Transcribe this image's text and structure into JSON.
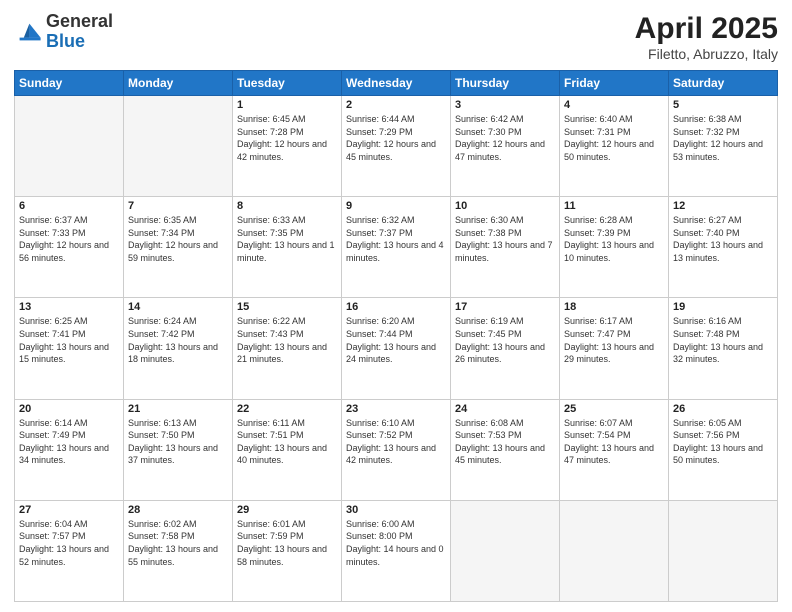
{
  "header": {
    "logo_general": "General",
    "logo_blue": "Blue",
    "title": "April 2025",
    "subtitle": "Filetto, Abruzzo, Italy"
  },
  "days_of_week": [
    "Sunday",
    "Monday",
    "Tuesday",
    "Wednesday",
    "Thursday",
    "Friday",
    "Saturday"
  ],
  "weeks": [
    [
      {
        "day": "",
        "empty": true
      },
      {
        "day": "",
        "empty": true
      },
      {
        "day": "1",
        "sunrise": "6:45 AM",
        "sunset": "7:28 PM",
        "daylight": "12 hours and 42 minutes."
      },
      {
        "day": "2",
        "sunrise": "6:44 AM",
        "sunset": "7:29 PM",
        "daylight": "12 hours and 45 minutes."
      },
      {
        "day": "3",
        "sunrise": "6:42 AM",
        "sunset": "7:30 PM",
        "daylight": "12 hours and 47 minutes."
      },
      {
        "day": "4",
        "sunrise": "6:40 AM",
        "sunset": "7:31 PM",
        "daylight": "12 hours and 50 minutes."
      },
      {
        "day": "5",
        "sunrise": "6:38 AM",
        "sunset": "7:32 PM",
        "daylight": "12 hours and 53 minutes."
      }
    ],
    [
      {
        "day": "6",
        "sunrise": "6:37 AM",
        "sunset": "7:33 PM",
        "daylight": "12 hours and 56 minutes."
      },
      {
        "day": "7",
        "sunrise": "6:35 AM",
        "sunset": "7:34 PM",
        "daylight": "12 hours and 59 minutes."
      },
      {
        "day": "8",
        "sunrise": "6:33 AM",
        "sunset": "7:35 PM",
        "daylight": "13 hours and 1 minute."
      },
      {
        "day": "9",
        "sunrise": "6:32 AM",
        "sunset": "7:37 PM",
        "daylight": "13 hours and 4 minutes."
      },
      {
        "day": "10",
        "sunrise": "6:30 AM",
        "sunset": "7:38 PM",
        "daylight": "13 hours and 7 minutes."
      },
      {
        "day": "11",
        "sunrise": "6:28 AM",
        "sunset": "7:39 PM",
        "daylight": "13 hours and 10 minutes."
      },
      {
        "day": "12",
        "sunrise": "6:27 AM",
        "sunset": "7:40 PM",
        "daylight": "13 hours and 13 minutes."
      }
    ],
    [
      {
        "day": "13",
        "sunrise": "6:25 AM",
        "sunset": "7:41 PM",
        "daylight": "13 hours and 15 minutes."
      },
      {
        "day": "14",
        "sunrise": "6:24 AM",
        "sunset": "7:42 PM",
        "daylight": "13 hours and 18 minutes."
      },
      {
        "day": "15",
        "sunrise": "6:22 AM",
        "sunset": "7:43 PM",
        "daylight": "13 hours and 21 minutes."
      },
      {
        "day": "16",
        "sunrise": "6:20 AM",
        "sunset": "7:44 PM",
        "daylight": "13 hours and 24 minutes."
      },
      {
        "day": "17",
        "sunrise": "6:19 AM",
        "sunset": "7:45 PM",
        "daylight": "13 hours and 26 minutes."
      },
      {
        "day": "18",
        "sunrise": "6:17 AM",
        "sunset": "7:47 PM",
        "daylight": "13 hours and 29 minutes."
      },
      {
        "day": "19",
        "sunrise": "6:16 AM",
        "sunset": "7:48 PM",
        "daylight": "13 hours and 32 minutes."
      }
    ],
    [
      {
        "day": "20",
        "sunrise": "6:14 AM",
        "sunset": "7:49 PM",
        "daylight": "13 hours and 34 minutes."
      },
      {
        "day": "21",
        "sunrise": "6:13 AM",
        "sunset": "7:50 PM",
        "daylight": "13 hours and 37 minutes."
      },
      {
        "day": "22",
        "sunrise": "6:11 AM",
        "sunset": "7:51 PM",
        "daylight": "13 hours and 40 minutes."
      },
      {
        "day": "23",
        "sunrise": "6:10 AM",
        "sunset": "7:52 PM",
        "daylight": "13 hours and 42 minutes."
      },
      {
        "day": "24",
        "sunrise": "6:08 AM",
        "sunset": "7:53 PM",
        "daylight": "13 hours and 45 minutes."
      },
      {
        "day": "25",
        "sunrise": "6:07 AM",
        "sunset": "7:54 PM",
        "daylight": "13 hours and 47 minutes."
      },
      {
        "day": "26",
        "sunrise": "6:05 AM",
        "sunset": "7:56 PM",
        "daylight": "13 hours and 50 minutes."
      }
    ],
    [
      {
        "day": "27",
        "sunrise": "6:04 AM",
        "sunset": "7:57 PM",
        "daylight": "13 hours and 52 minutes."
      },
      {
        "day": "28",
        "sunrise": "6:02 AM",
        "sunset": "7:58 PM",
        "daylight": "13 hours and 55 minutes."
      },
      {
        "day": "29",
        "sunrise": "6:01 AM",
        "sunset": "7:59 PM",
        "daylight": "13 hours and 58 minutes."
      },
      {
        "day": "30",
        "sunrise": "6:00 AM",
        "sunset": "8:00 PM",
        "daylight": "14 hours and 0 minutes."
      },
      {
        "day": "",
        "empty": true
      },
      {
        "day": "",
        "empty": true
      },
      {
        "day": "",
        "empty": true
      }
    ]
  ]
}
